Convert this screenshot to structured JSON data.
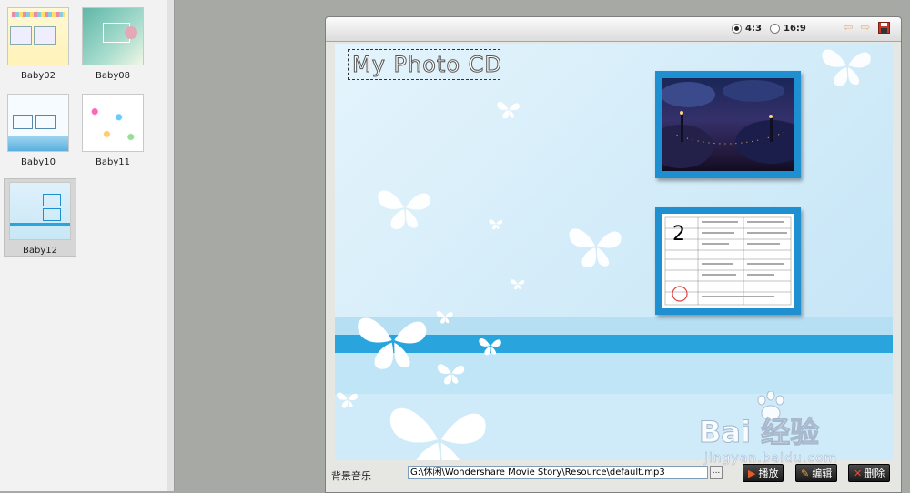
{
  "templates": [
    {
      "label": "Baby02"
    },
    {
      "label": "Baby08"
    },
    {
      "label": "Baby10"
    },
    {
      "label": "Baby11"
    },
    {
      "label": "Baby12",
      "selected": true
    }
  ],
  "toolbar": {
    "ratio_options": [
      {
        "label": "4:3",
        "selected": true
      },
      {
        "label": "16:9",
        "selected": false
      }
    ],
    "icons": [
      "back-arrow-icon",
      "forward-arrow-icon",
      "save-icon"
    ]
  },
  "canvas": {
    "title_text": "My Photo CD",
    "slot_number": "2"
  },
  "music": {
    "label": "背景音乐",
    "path": "G:\\休闲\\Wondershare Movie Story\\Resource\\default.mp3",
    "browse_label": "..."
  },
  "buttons": {
    "play": "播放",
    "edit": "编辑",
    "delete": "删除"
  },
  "watermark": {
    "text": "Bai  经验",
    "sub": "jingyan.baidu.com"
  },
  "colors": {
    "band_accent": "#2aa4dc",
    "frame": "#1e8fd0",
    "canvas_bg": "#cfeaf8"
  }
}
